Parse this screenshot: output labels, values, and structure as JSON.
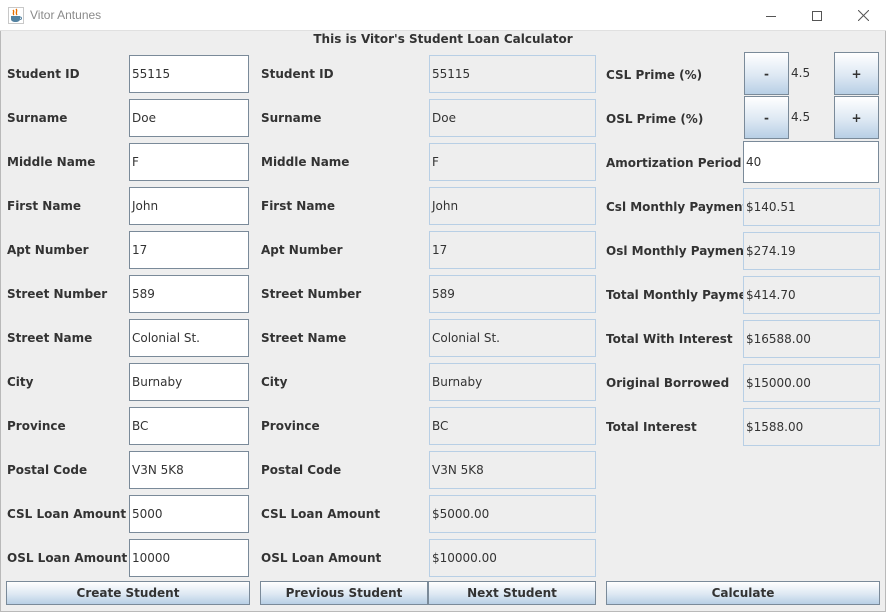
{
  "window": {
    "title": "Vitor Antunes"
  },
  "heading": "This is Vitor's Student Loan Calculator",
  "input_form": {
    "fields": [
      {
        "label": "Student ID",
        "value": "55115"
      },
      {
        "label": "Surname",
        "value": "Doe"
      },
      {
        "label": "Middle Name",
        "value": "F"
      },
      {
        "label": "First Name",
        "value": "John"
      },
      {
        "label": "Apt Number",
        "value": "17"
      },
      {
        "label": "Street Number",
        "value": "589"
      },
      {
        "label": "Street Name",
        "value": "Colonial St."
      },
      {
        "label": "City",
        "value": "Burnaby"
      },
      {
        "label": "Province",
        "value": "BC"
      },
      {
        "label": "Postal Code",
        "value": "V3N 5K8"
      },
      {
        "label": "CSL Loan Amount ($)",
        "value": "5000"
      },
      {
        "label": "OSL Loan Amount ($)",
        "value": "10000"
      }
    ]
  },
  "display_form": {
    "fields": [
      {
        "label": "Student ID",
        "value": "55115"
      },
      {
        "label": "Surname",
        "value": "Doe"
      },
      {
        "label": "Middle Name",
        "value": "F"
      },
      {
        "label": "First Name",
        "value": "John"
      },
      {
        "label": "Apt Number",
        "value": "17"
      },
      {
        "label": "Street Number",
        "value": "589"
      },
      {
        "label": "Street Name",
        "value": "Colonial St."
      },
      {
        "label": "City",
        "value": "Burnaby"
      },
      {
        "label": "Province",
        "value": "BC"
      },
      {
        "label": "Postal Code",
        "value": "V3N 5K8"
      },
      {
        "label": "CSL Loan Amount",
        "value": "$5000.00"
      },
      {
        "label": "OSL Loan Amount",
        "value": "$10000.00"
      }
    ]
  },
  "calculator": {
    "csl_prime": {
      "label": "CSL Prime (%)",
      "value": "4.5",
      "minus": "-",
      "plus": "+"
    },
    "osl_prime": {
      "label": "OSL Prime (%)",
      "value": "4.5",
      "minus": "-",
      "plus": "+"
    },
    "amortization": {
      "label": "Amortization Period",
      "value": "40"
    },
    "results": [
      {
        "label": "Csl Monthly Payments",
        "value": "$140.51"
      },
      {
        "label": "Osl Monthly Payments",
        "value": "$274.19"
      },
      {
        "label": "Total Monthly Payments",
        "value": "$414.70"
      },
      {
        "label": "Total With Interest",
        "value": "$16588.00"
      },
      {
        "label": "Original Borrowed",
        "value": "$15000.00"
      },
      {
        "label": "Total Interest",
        "value": "$1588.00"
      }
    ]
  },
  "buttons": {
    "create": "Create Student",
    "previous": "Previous Student",
    "next": "Next Student",
    "calculate": "Calculate"
  },
  "icons": {
    "app": "java-coffee-cup-icon",
    "minimize": "minimize-icon",
    "maximize": "maximize-icon",
    "close": "close-icon"
  },
  "colors": {
    "button_gradient_top": "#ffffff",
    "button_gradient_bottom": "#b8cfe5",
    "readonly_border": "#b8cfe5",
    "window_bg": "#eeeeee"
  }
}
